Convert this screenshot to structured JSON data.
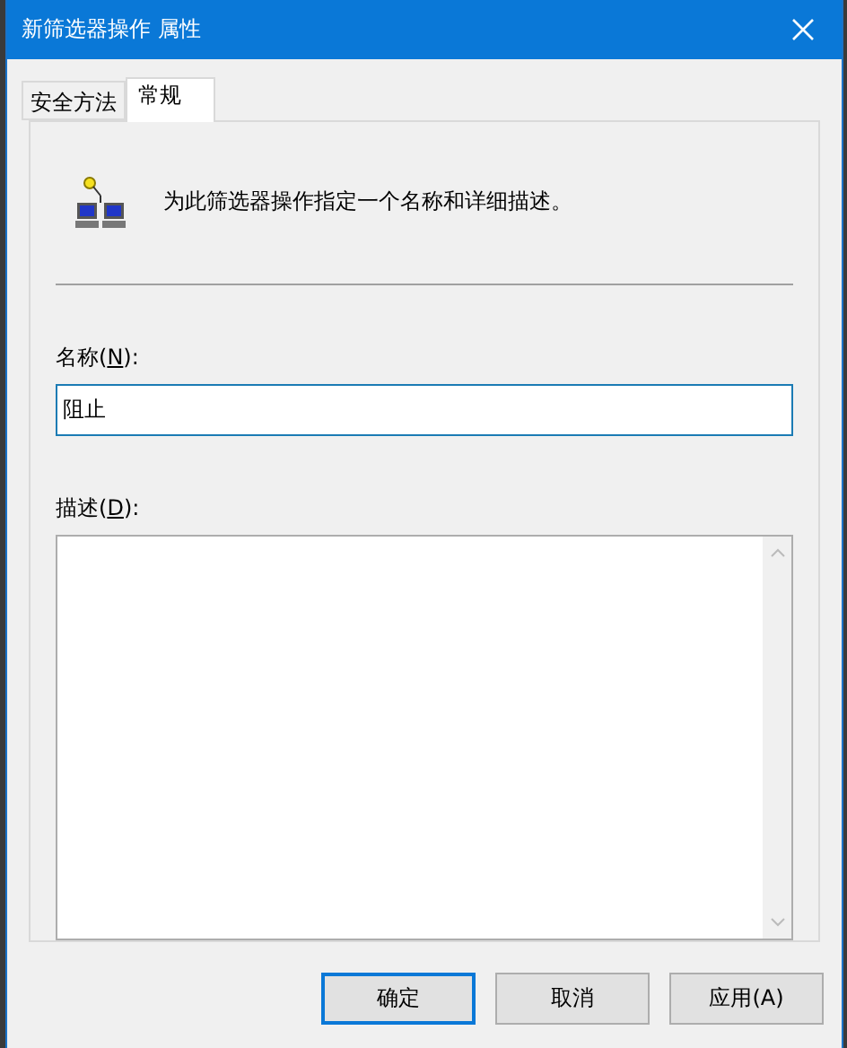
{
  "window": {
    "title": "新筛选器操作 属性"
  },
  "tabs": [
    {
      "label": "安全方法",
      "selected": false
    },
    {
      "label": "常规",
      "selected": true
    }
  ],
  "intro": "为此筛选器操作指定一个名称和详细描述。",
  "name_field": {
    "label_before": "名称(",
    "access_key": "N",
    "label_after": "):",
    "value": "阻止"
  },
  "description_field": {
    "label_before": "描述(",
    "access_key": "D",
    "label_after": "):"
  },
  "buttons": [
    {
      "label": "确定",
      "default": true
    },
    {
      "label": "取消",
      "default": false
    },
    {
      "label": "应用(A)",
      "default": false
    }
  ]
}
